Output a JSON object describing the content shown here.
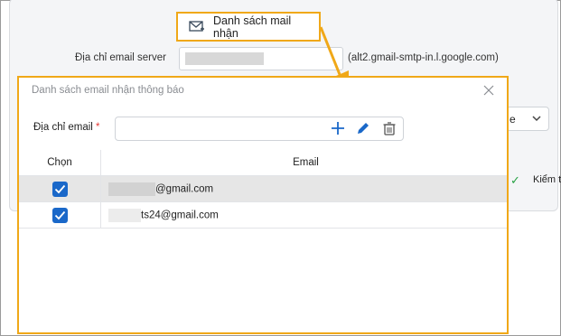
{
  "background": {
    "toolbar_button_label": "Danh sách mail nhận",
    "server_label": "Địa chỉ email server",
    "server_hint": "(alt2.gmail-smtp-in.l.google.com)",
    "select_value": "e",
    "right_cut_text": "Kiểm t"
  },
  "dialog": {
    "title": "Danh sách email nhận thông báo",
    "email_label": "Địa chỉ email",
    "required_mark": "*",
    "email_value": "",
    "columns": {
      "select": "Chọn",
      "email": "Email"
    },
    "rows": [
      {
        "email_suffix": "@gmail.com",
        "checked": true,
        "selected": true
      },
      {
        "email_suffix": "ts24@gmail.com",
        "checked": true,
        "selected": false
      }
    ]
  },
  "colors": {
    "highlight": "#f0a818",
    "accent": "#1a68c9",
    "ok_green": "#27a244"
  },
  "icons": [
    "mail-list-icon",
    "close-icon",
    "add-icon",
    "edit-icon",
    "delete-icon",
    "chevron-down-icon",
    "check-icon"
  ]
}
